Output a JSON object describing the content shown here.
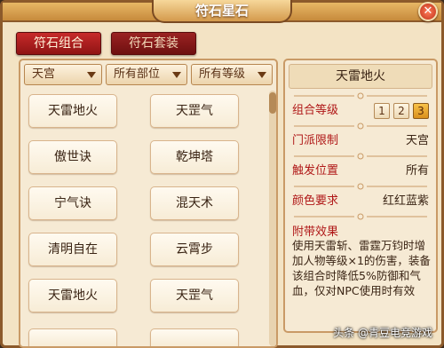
{
  "window": {
    "title": "符石星石",
    "close_glyph": "✕"
  },
  "tabs": [
    {
      "label": "符石组合",
      "active": true
    },
    {
      "label": "符石套装",
      "active": false
    }
  ],
  "filters": [
    {
      "value": "天宫"
    },
    {
      "value": "所有部位"
    },
    {
      "value": "所有等级"
    }
  ],
  "combo_list": [
    "天雷地火",
    "天罡气",
    "傲世诀",
    "乾坤塔",
    "宁气诀",
    "混天术",
    "清明自在",
    "云霄步",
    "天雷地火",
    "天罡气",
    "",
    ""
  ],
  "detail": {
    "title": "天雷地火",
    "level_label": "组合等级",
    "levels": [
      "1",
      "2",
      "3"
    ],
    "active_level": "3",
    "sect_label": "门派限制",
    "sect_value": "天宫",
    "trigger_label": "触发位置",
    "trigger_value": "所有",
    "color_label": "颜色要求",
    "color_value": "红红蓝紫",
    "effect_label": "附带效果",
    "effect_text": "使用天雷斩、雷霆万钧时增加人物等级×1的伤害，装备该组合时降低5%防御和气血，仅对NPC使用时有效"
  },
  "watermark": "头条 @青豆电竞游戏",
  "colors": {
    "panel_bg": "#f3e3c4",
    "tab_red": "#c72a2a",
    "label_red": "#b01818",
    "active_level_gold": "#f8c24a"
  }
}
